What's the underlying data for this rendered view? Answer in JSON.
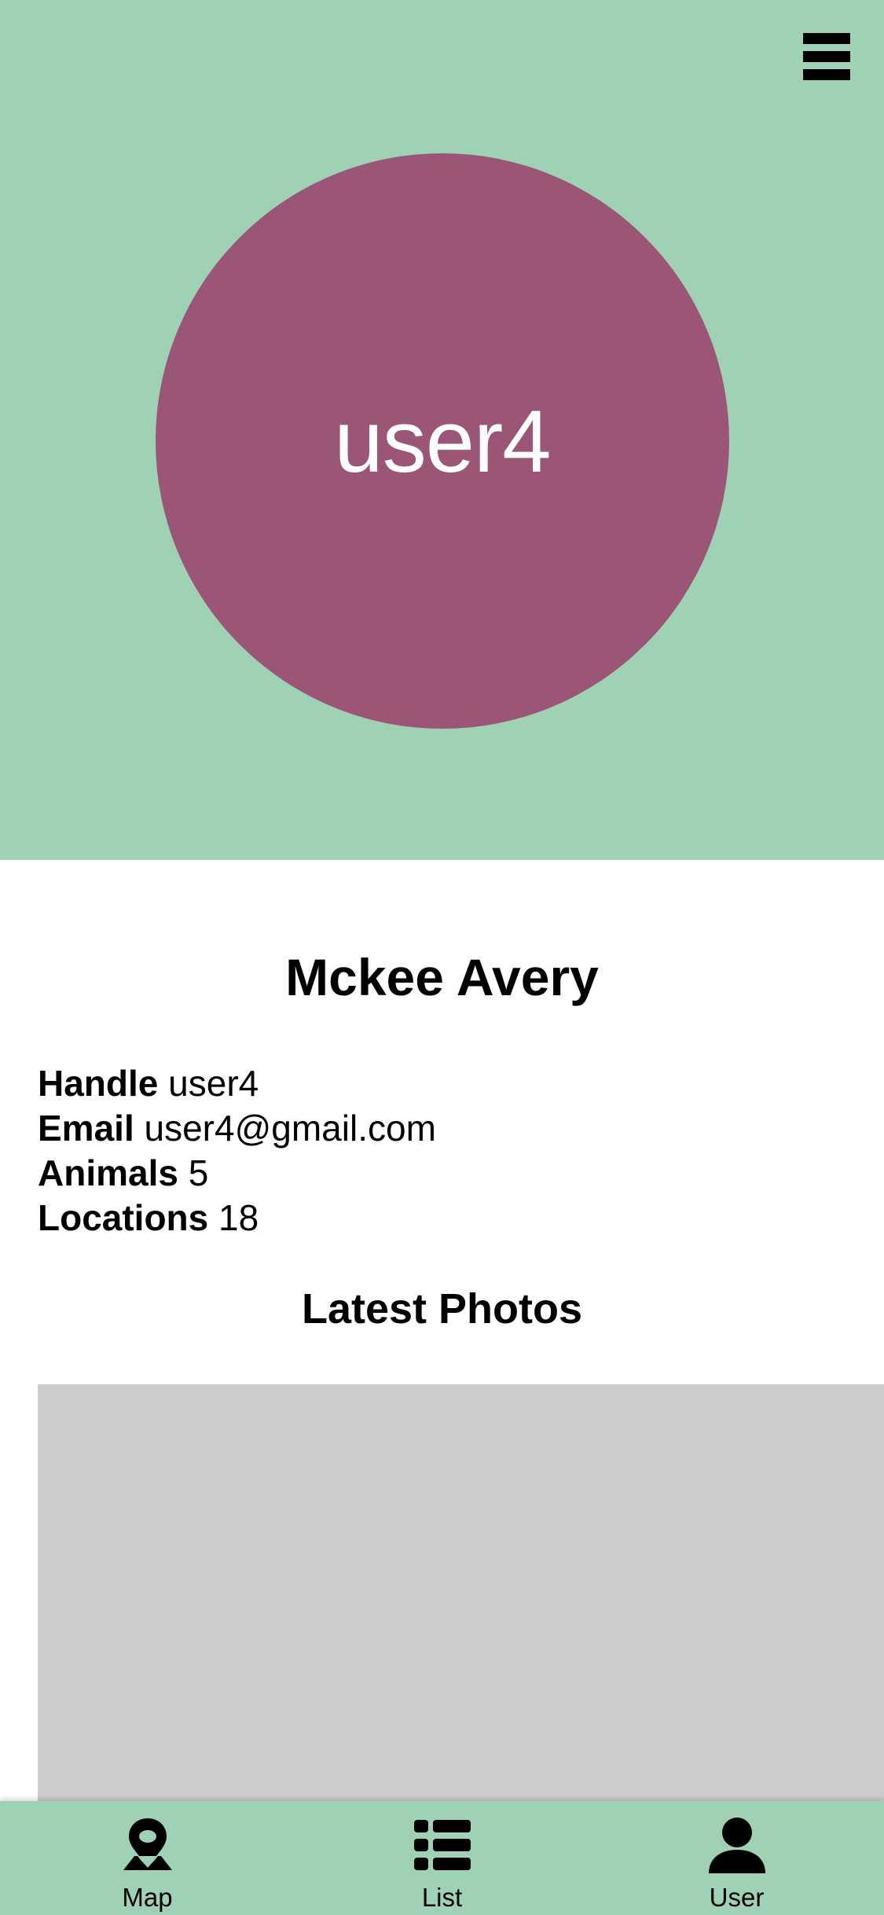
{
  "header": {
    "menu_icon": "hamburger-menu-icon",
    "avatar_text": "user4",
    "colors": {
      "hero_bg": "#9fd1b5",
      "avatar_bg": "#9b5576"
    }
  },
  "profile": {
    "name": "Mckee Avery",
    "details": [
      {
        "label": "Handle",
        "value": "user4"
      },
      {
        "label": "Email",
        "value": "user4@gmail.com"
      },
      {
        "label": "Animals",
        "value": "5"
      },
      {
        "label": "Locations",
        "value": "18"
      }
    ]
  },
  "photos": {
    "title": "Latest Photos"
  },
  "tabbar": {
    "tabs": [
      {
        "label": "Map",
        "icon": "map-pin-icon"
      },
      {
        "label": "List",
        "icon": "list-icon"
      },
      {
        "label": "User",
        "icon": "user-icon"
      }
    ]
  }
}
